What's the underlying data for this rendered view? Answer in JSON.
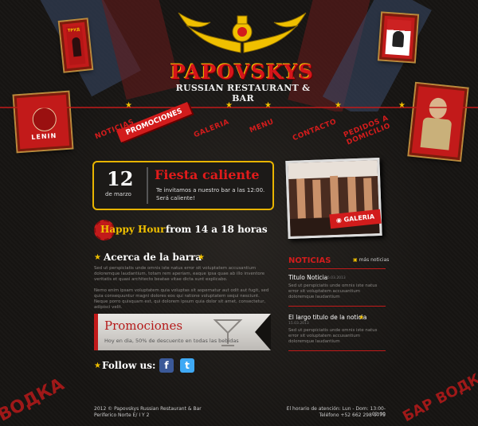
{
  "logo": {
    "title": "PAPOVSKYS",
    "subtitle": "RUSSIAN RESTAURANT & BAR"
  },
  "posters": {
    "top_left_text": "ТРУД",
    "left_text": "LENIN"
  },
  "nav": {
    "items": [
      {
        "label": "Noticias"
      },
      {
        "label": "Promociones"
      },
      {
        "label": "Galeria"
      },
      {
        "label": "Menu"
      },
      {
        "label": "Contacto"
      },
      {
        "label": "Pedidos a domicilio"
      }
    ]
  },
  "event": {
    "day": "12",
    "month": "de marzo",
    "title": "Fiesta caliente",
    "text": "Te invitamos a nuestro bar a las 12:00. Será caliente!"
  },
  "happy_hour": {
    "title": "Happy Hour",
    "text": "from 14 a 18 horas"
  },
  "gallery": {
    "label": "GALERIA"
  },
  "about": {
    "title": "Acerca de la barra",
    "p1": "Sed ut perspiciatis unde omnis iste natus error sit voluptatem accusantium doloremque laudantium, totam rem aperiam, eaque ipsa quae ab illo inventore veritatis et quasi architecto beatae vitae dicta sunt explicabo.",
    "p2": "Nemo enim ipsam voluptatem quia voluptas sit aspernatur aut odit aut fugit, sed quia consequuntur magni dolores eos qui ratione voluptatem sequi nesciunt. Neque porro quisquam est, qui dolorem ipsum quia dolor sit amet, consectetur, adipisci velit."
  },
  "promo": {
    "title": "Promociones",
    "text": "Hoy en dia, 50% de descuento en todas las bebidas"
  },
  "follow": {
    "label": "Follow us:",
    "facebook": "f",
    "twitter": "t"
  },
  "news": {
    "title": "NOTICIAS",
    "more": "más noticias",
    "items": [
      {
        "title": "Titulo Noticia",
        "date": "15.03.2013",
        "text": "Sed ut perspiciatis unde omnis iste natus error sit voluptatem accusantium doloremque laudantium"
      },
      {
        "title": "El largo titulo de la noticia",
        "date": "15.03.2013",
        "text": "Sed ut perspiciatis unde omnis iste natus error sit voluptatem accusantium doloremque laudantium"
      }
    ]
  },
  "footer": {
    "copyright": "2012 © Papovskys Russian Restaurant & Bar",
    "address": "Periferico Norte E/ I Y 2",
    "hours": "El horario de atención: Lun - Dom: 13:00-02:00",
    "phone": "Teléfono +52 662 298 0775"
  },
  "stamp_text": {
    "bottom_left": "ВОДКА",
    "bottom_right": "БАР ВОДКА"
  },
  "colors": {
    "accent_red": "#d21c1c",
    "gold": "#f0c000",
    "background": "#141210"
  }
}
